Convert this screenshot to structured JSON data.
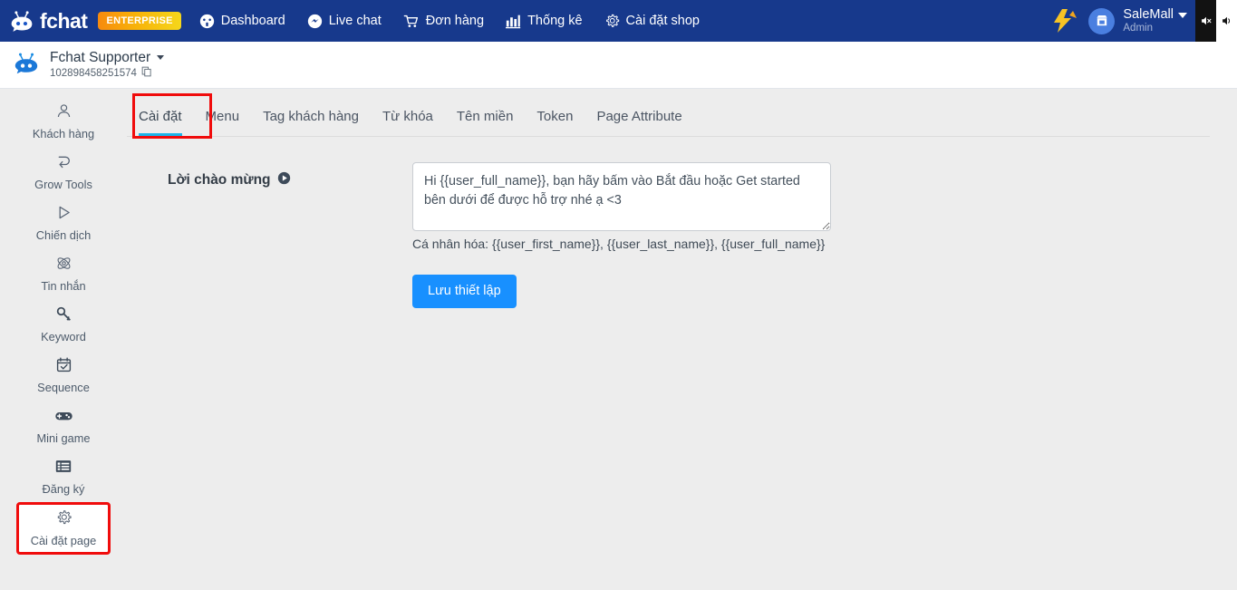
{
  "topnav": {
    "brand_text": "fchat",
    "badge": "ENTERPRISE",
    "items": [
      {
        "label": "Dashboard",
        "icon": "dashboard-icon"
      },
      {
        "label": "Live chat",
        "icon": "messenger-icon"
      },
      {
        "label": "Đơn hàng",
        "icon": "cart-icon"
      },
      {
        "label": "Thống kê",
        "icon": "bar-chart-icon"
      },
      {
        "label": "Cài đặt shop",
        "icon": "gear-icon"
      }
    ],
    "account": {
      "name": "SaleMall",
      "role": "Admin"
    },
    "colors": {
      "nav_bg": "#17398c",
      "badge_from": "#f78a0e",
      "badge_to": "#f5d71b"
    }
  },
  "pageheader": {
    "page_name": "Fchat Supporter",
    "page_id": "102898458251574"
  },
  "sidebar": {
    "items": [
      {
        "label": "Khách hàng",
        "icon": "user-icon",
        "active": false
      },
      {
        "label": "Grow Tools",
        "icon": "growtools-icon",
        "active": false
      },
      {
        "label": "Chiến dịch",
        "icon": "play-icon",
        "active": false
      },
      {
        "label": "Tin nhắn",
        "icon": "atom-icon",
        "active": false
      },
      {
        "label": "Keyword",
        "icon": "key-icon",
        "active": false
      },
      {
        "label": "Sequence",
        "icon": "calendar-check-icon",
        "active": false
      },
      {
        "label": "Mini game",
        "icon": "gamepad-icon",
        "active": false
      },
      {
        "label": "Đăng ký",
        "icon": "list-icon",
        "active": false
      },
      {
        "label": "Cài đặt page",
        "icon": "gear-icon",
        "active": true
      }
    ]
  },
  "main": {
    "tabs": [
      {
        "label": "Cài đặt",
        "active": true
      },
      {
        "label": "Menu",
        "active": false
      },
      {
        "label": "Tag khách hàng",
        "active": false
      },
      {
        "label": "Từ khóa",
        "active": false
      },
      {
        "label": "Tên miền",
        "active": false
      },
      {
        "label": "Token",
        "active": false
      },
      {
        "label": "Page Attribute",
        "active": false
      }
    ],
    "form": {
      "label": "Lời chào mừng",
      "textarea_value": "Hi {{user_full_name}}, bạn hãy bấm vào Bắt đầu hoặc Get started bên dưới để được hỗ trợ nhé ạ <3",
      "textarea_placeholder": "",
      "helper": "Cá nhân hóa: {{user_first_name}}, {{user_last_name}}, {{user_full_name}}",
      "save_label": "Lưu thiết lập",
      "accent": "#1890ff"
    }
  },
  "highlights": {
    "color": "#f00c0c"
  }
}
